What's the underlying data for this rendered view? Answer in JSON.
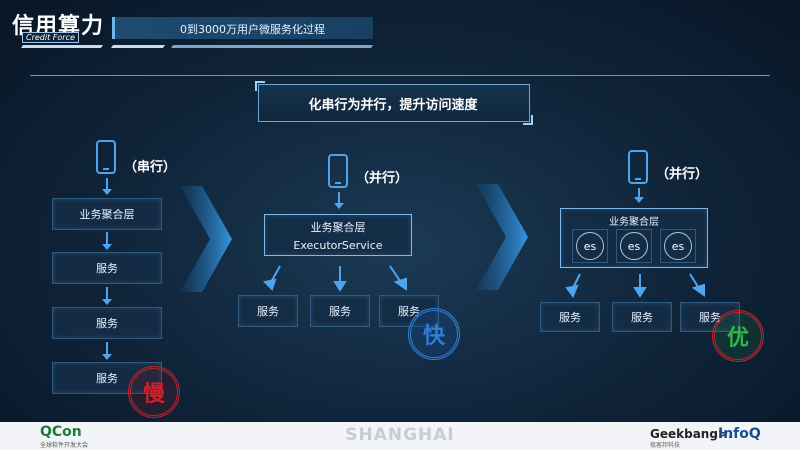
{
  "header": {
    "logo": "信用算力",
    "logo_sub": "Credit Force",
    "title": "0到3000万用户微服务化过程"
  },
  "banner": {
    "text": "化串行为并行，提升访问速度"
  },
  "serial": {
    "mode_label": "（串行）",
    "aggregation": "业务聚合层",
    "services": [
      "服务",
      "服务",
      "服务"
    ],
    "stamp": "慢",
    "stamp_color": "#d0202a"
  },
  "parallel": {
    "mode_label": "（并行）",
    "aggregation": "业务聚合层",
    "executor": "ExecutorService",
    "services": [
      "服务",
      "服务",
      "服务"
    ],
    "stamp": "快",
    "stamp_color": "#2f7fd6"
  },
  "parallel_es": {
    "mode_label": "（并行）",
    "aggregation": "业务聚合层",
    "es_labels": [
      "es",
      "es",
      "es"
    ],
    "services": [
      "服务",
      "服务",
      "服务"
    ],
    "stamp": "优",
    "stamp_color": "#2fb84a"
  },
  "footer": {
    "qcon": "QCon",
    "qcon_sub": "全球软件开发大会",
    "city": "SHANGHAI",
    "geekbang": "Geekbang>.",
    "geekbang_sub": "极客邦科技",
    "infoq": "InfoQ"
  }
}
